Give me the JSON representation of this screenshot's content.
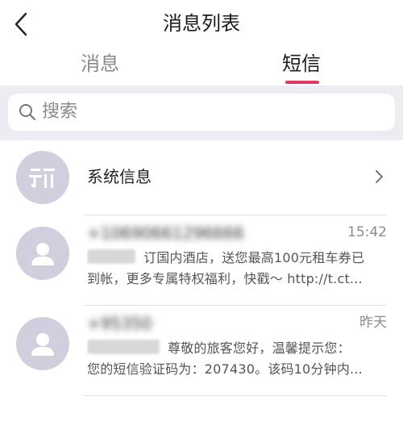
{
  "header": {
    "title": "消息列表"
  },
  "tabs": [
    {
      "label": "消息",
      "active": false
    },
    {
      "label": "短信",
      "active": true
    }
  ],
  "search": {
    "placeholder": "搜索"
  },
  "system_item": {
    "label": "系统信息",
    "icon": "system-notice-icon"
  },
  "messages": [
    {
      "sender": "+10690661296666",
      "time": "15:42",
      "line1": "订国内酒店，送您最高100元租车券已",
      "line2": "到帐，更多专属特权福利，快戳～ http://t.ct..."
    },
    {
      "sender": "+95350",
      "time": "昨天",
      "line1": "尊敬的旅客您好，温馨提示您：",
      "line2": "您的短信验证码为：207430。该码10分钟内..."
    }
  ],
  "colors": {
    "accent": "#e23a62",
    "search_bg": "#eeecf3",
    "avatar_bg": "#cfcfde"
  }
}
